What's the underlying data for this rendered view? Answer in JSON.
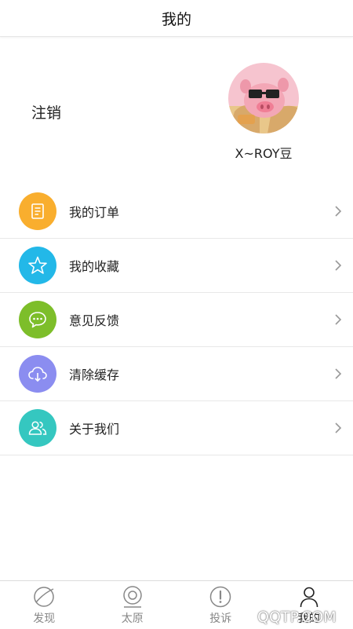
{
  "header": {
    "title": "我的"
  },
  "profile": {
    "logout_label": "注销",
    "username": "X~ROY豆"
  },
  "menu": {
    "items": [
      {
        "label": "我的订单",
        "icon": "document-icon",
        "color": "#F9AE2E"
      },
      {
        "label": "我的收藏",
        "icon": "star-icon",
        "color": "#23B8E8"
      },
      {
        "label": "意见反馈",
        "icon": "chat-bubble-icon",
        "color": "#7DBE2A"
      },
      {
        "label": "清除缓存",
        "icon": "cloud-download-icon",
        "color": "#8B8DF0"
      },
      {
        "label": "关于我们",
        "icon": "people-icon",
        "color": "#35C7C0"
      }
    ]
  },
  "tabbar": {
    "tabs": [
      {
        "label": "发现",
        "icon": "planet-icon",
        "active": false
      },
      {
        "label": "太原",
        "icon": "location-pin-icon",
        "active": false
      },
      {
        "label": "投诉",
        "icon": "alert-icon",
        "active": false
      },
      {
        "label": "我的",
        "icon": "user-icon",
        "active": true
      }
    ]
  },
  "watermark": "QQTP.COM"
}
